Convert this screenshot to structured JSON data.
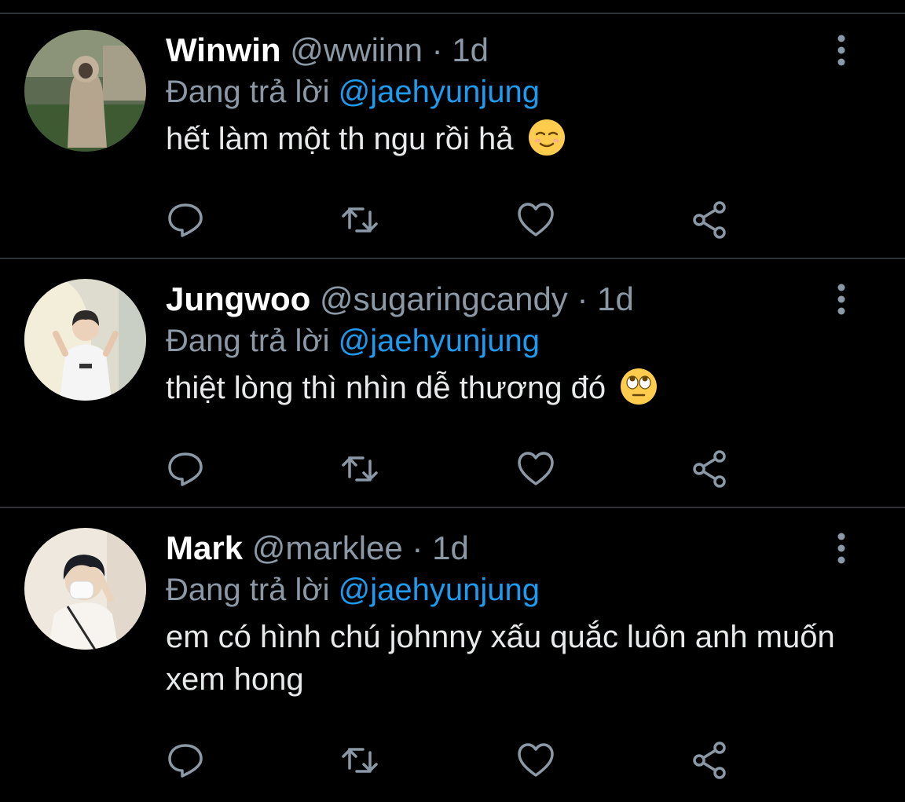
{
  "reply_prefix": "Đang trả lời",
  "tweets": [
    {
      "name": "Winwin",
      "handle": "@wwiinn",
      "separator": "·",
      "time": "1d",
      "mention": "@jaehyunjung",
      "text": "hết làm một th ngu rồi hả",
      "emoji": "relieved-face-emoji"
    },
    {
      "name": "Jungwoo",
      "handle": "@sugaringcandy",
      "separator": "·",
      "time": "1d",
      "mention": "@jaehyunjung",
      "text": "thiệt lòng thì nhìn dễ thương đó",
      "emoji": "rolling-eyes-emoji"
    },
    {
      "name": "Mark",
      "handle": "@marklee",
      "separator": "·",
      "time": "1d",
      "mention": "@jaehyunjung",
      "text": "em có hình chú johnny xấu quắc luôn anh muốn xem hong",
      "emoji": ""
    }
  ],
  "icons": [
    "more-options-icon",
    "reply-icon",
    "retweet-icon",
    "like-icon",
    "share-icon"
  ],
  "colors": {
    "background": "#000000",
    "divider": "#2f3336",
    "secondary_text": "#8b98a5",
    "mention": "#1d9bf0",
    "icon": "#8b98a5"
  }
}
